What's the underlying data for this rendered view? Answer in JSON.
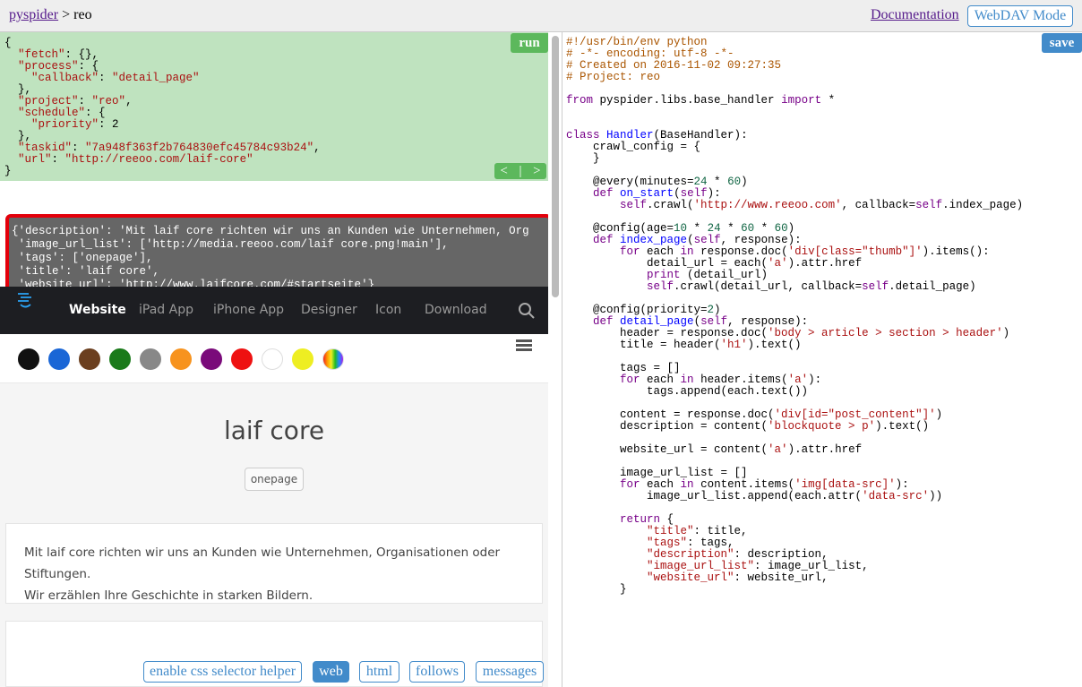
{
  "header": {
    "app_link": "pyspider",
    "separator": ">",
    "project": "reo",
    "doc_link": "Documentation",
    "webdav_button": "WebDAV Mode"
  },
  "task": {
    "run_label": "run",
    "json_lines": [
      "{",
      "  \"fetch\": {},",
      "  \"process\": {",
      "    \"callback\": \"detail_page\"",
      "  },",
      "  \"project\": \"reo\",",
      "  \"schedule\": {",
      "    \"priority\": 2",
      "  },",
      "  \"taskid\": \"7a948f363f2b764830efc45784c93b24\",",
      "  \"url\": \"http://reeoo.com/laif-core\"",
      "}"
    ],
    "pager": [
      "<",
      "|",
      ">"
    ]
  },
  "result": {
    "lines": [
      "{'description': 'Mit laif core richten wir uns an Kunden wie Unternehmen, Org",
      " 'image_url_list': ['http://media.reeoo.com/laif core.png!main'],",
      " 'tags': ['onepage'],",
      " 'title': 'laif core',",
      " 'website_url': 'http://www.laifcore.com/#startseite'}"
    ]
  },
  "preview": {
    "nav_items": [
      "Website",
      "iPad App",
      "iPhone App",
      "Designer",
      "Icon",
      "Download"
    ],
    "active_nav": "Website",
    "color_swatches": [
      "#111111",
      "#1a66d6",
      "#6b3f1f",
      "#1a7a1a",
      "#888888",
      "#f7931e",
      "#7a0a7a",
      "#ee1111",
      "#ffffff",
      "#eeee22",
      "rainbow"
    ],
    "title": "laif core",
    "tag": "onepage",
    "description_line1": "Mit laif core richten wir uns an Kunden wie Unternehmen, Organisationen oder Stiftungen.",
    "description_line2": "Wir erzählen Ihre Geschichte in starken Bildern."
  },
  "tools": {
    "css_helper": "enable css selector helper",
    "web": "web",
    "html": "html",
    "follows": "follows",
    "messages": "messages"
  },
  "editor": {
    "save_label": "save"
  }
}
